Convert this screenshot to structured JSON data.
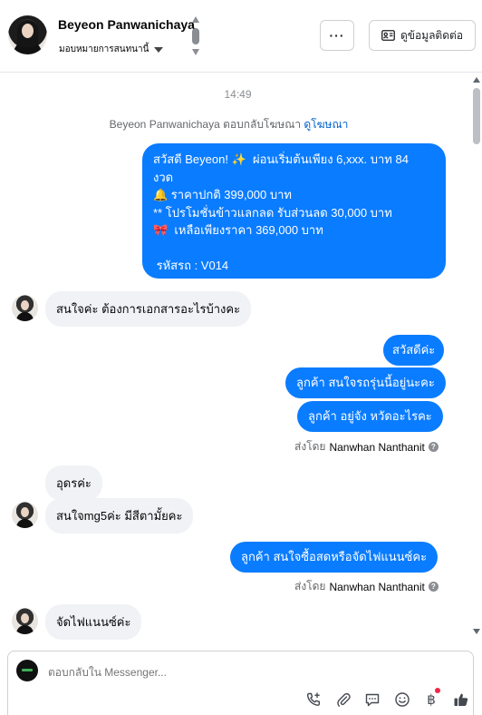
{
  "header": {
    "contact_name": "Beyeon Panwanichaya",
    "assign_label": "มอบหมายการสนทนานี้",
    "more_label": "···",
    "contact_info_label": "ดูข้อมูลติดต่อ"
  },
  "chat": {
    "timestamp": "14:49",
    "reply_context": {
      "text": "Beyeon Panwanichaya ตอบกลับโฆษณา",
      "link": "ดูโฆษณา"
    },
    "messages": [
      {
        "direction": "outgoing",
        "lines": [
          "สวัสดี Beyeon! ✨  ผ่อนเริ่มต้นเพียง 6,xxx. บาท 84",
          "งวด",
          "🔔 ราคาปกติ 399,000 บาท",
          "** โปรโมชั่นข้าวแลกลด รับส่วนลด 30,000 บาท",
          "🎀  เหลือเพียงราคา 369,000 บาท",
          "",
          " รหัสรถ : V014"
        ]
      },
      {
        "direction": "incoming",
        "text": "สนใจค่ะ ต้องการเอกสารอะไรบ้างคะ"
      },
      {
        "direction": "outgoing",
        "text": "สวัสดีค่ะ"
      },
      {
        "direction": "outgoing",
        "text": "ลูกค้า สนใจรถรุ่นนี้อยู่นะคะ"
      },
      {
        "direction": "outgoing",
        "text": "ลูกค้า อยู่จัง หวัดอะไรคะ"
      },
      {
        "direction": "outgoing-meta",
        "sent_by_label": "ส่งโดย",
        "sender": "Nanwhan Nanthanit"
      },
      {
        "direction": "incoming",
        "text": "อุดรค่ะ"
      },
      {
        "direction": "incoming",
        "text": "สนใจmg5ค่ะ มีสีตามั้ยคะ"
      },
      {
        "direction": "outgoing",
        "text": "ลูกค้า สนใจซื้อสดหรือจัดไฟแนนซ์คะ"
      },
      {
        "direction": "outgoing-meta",
        "sent_by_label": "ส่งโดย",
        "sender": "Nanwhan Nanthanit"
      },
      {
        "direction": "incoming",
        "text": "จัดไฟแนนซ์ค่ะ"
      }
    ]
  },
  "composer": {
    "placeholder": "ตอบกลับใน Messenger...",
    "tools": [
      "phone-plus-icon",
      "paperclip-icon",
      "message-icon",
      "emoji-icon",
      "currency-icon",
      "thumbs-up-icon"
    ]
  },
  "colors": {
    "accent": "#0a7cff",
    "incoming_bubble": "#f0f2f5",
    "link": "#0064d1",
    "notification_dot": "#f02849"
  }
}
